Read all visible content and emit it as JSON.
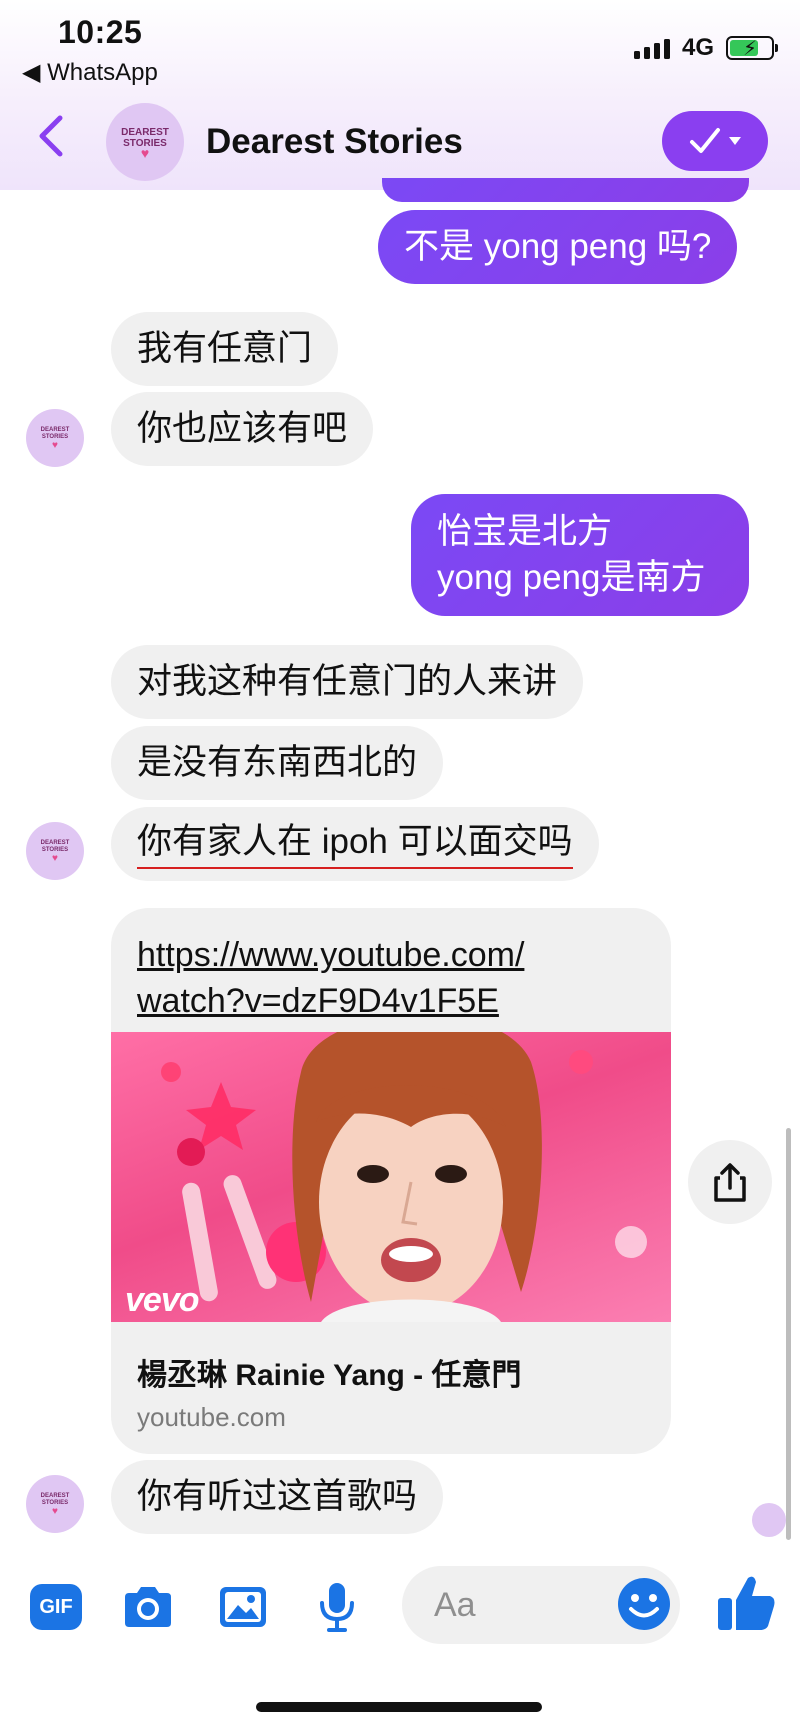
{
  "status_bar": {
    "time": "10:25",
    "back_app": "◀ WhatsApp",
    "network": "4G"
  },
  "header": {
    "title": "Dearest Stories",
    "avatar_text": "DEAREST STORIES",
    "accent_color": "#8a3ff0"
  },
  "messages": [
    {
      "dir": "out",
      "text": "不是 yong peng 吗?"
    },
    {
      "dir": "in",
      "text": "我有任意门"
    },
    {
      "dir": "in",
      "text": "你也应该有吧"
    },
    {
      "dir": "out",
      "lines": [
        "怡宝是北方",
        "yong peng是南方"
      ]
    },
    {
      "dir": "in",
      "text": "对我这种有任意门的人来讲"
    },
    {
      "dir": "in",
      "text": "是没有东南西北的"
    },
    {
      "dir": "in",
      "text": "你有家人在 ipoh 可以面交吗"
    },
    {
      "dir": "in",
      "text": "你有听过这首歌吗"
    }
  ],
  "link_preview": {
    "url_line1": "https://www.youtube.com/",
    "url_line2": "watch?v=dzF9D4v1F5E",
    "title": "楊丞琳 Rainie Yang - 任意門",
    "domain": "youtube.com",
    "thumbnail_label": "vevo"
  },
  "composer": {
    "placeholder": "Aa"
  },
  "icons": {
    "gif": "GIF",
    "camera": "camera-icon",
    "image": "image-icon",
    "mic": "mic-icon",
    "emoji": "emoji-icon",
    "like": "thumbs-up-icon",
    "share": "share-icon"
  },
  "colors": {
    "outgoing_bubble": "#7b49f5",
    "incoming_bubble": "#f0f0f0",
    "toolbar_blue": "#1b74e4"
  }
}
